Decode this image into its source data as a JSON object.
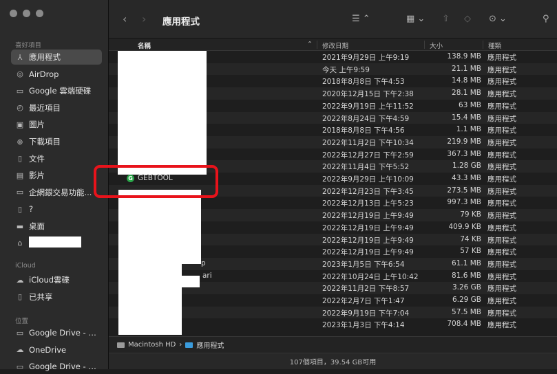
{
  "sidebar": {
    "favorites_title": "喜好項目",
    "items": [
      {
        "icon": "applications-icon",
        "glyph": "⅄",
        "label": "應用程式",
        "active": true
      },
      {
        "icon": "airdrop-icon",
        "glyph": "◎",
        "label": "AirDrop"
      },
      {
        "icon": "folder-icon",
        "glyph": "▭",
        "label": "Google 雲端硬碟"
      },
      {
        "icon": "clock-icon",
        "glyph": "◴",
        "label": "最近項目"
      },
      {
        "icon": "pictures-icon",
        "glyph": "▣",
        "label": "圖片"
      },
      {
        "icon": "download-icon",
        "glyph": "⊕",
        "label": "下載項目"
      },
      {
        "icon": "document-icon",
        "glyph": "▯",
        "label": "文件"
      },
      {
        "icon": "movies-icon",
        "glyph": "▤",
        "label": "影片"
      },
      {
        "icon": "folder-icon",
        "glyph": "▭",
        "label": "企網銀交易功能..."
      },
      {
        "icon": "document-icon",
        "glyph": "▯",
        "label": "?"
      },
      {
        "icon": "desktop-icon",
        "glyph": "▬",
        "label": "桌面"
      },
      {
        "icon": "home-icon",
        "glyph": "⌂",
        "label": ""
      }
    ],
    "icloud_title": "iCloud",
    "icloud_items": [
      {
        "icon": "cloud-icon",
        "glyph": "☁",
        "label": "iCloud雲碟"
      },
      {
        "icon": "shared-folder-icon",
        "glyph": "▯",
        "label": "已共享"
      }
    ],
    "locations_title": "位置",
    "location_items": [
      {
        "icon": "folder-icon",
        "glyph": "▭",
        "label": "Google Drive - g..."
      },
      {
        "icon": "cloud-icon",
        "glyph": "☁",
        "label": "OneDrive"
      },
      {
        "icon": "folder-icon",
        "glyph": "▭",
        "label": "Google Drive - b..."
      }
    ]
  },
  "toolbar": {
    "back": "‹",
    "forward": "›",
    "title": "應用程式",
    "view_icon": "list-view-icon",
    "group_icon": "group-icon",
    "share_icon": "share-icon",
    "tag_icon": "tag-icon",
    "more_icon": "more-icon",
    "search_icon": "search-icon"
  },
  "columns": {
    "name": "名稱",
    "date": "修改日期",
    "size": "大小",
    "kind": "種類"
  },
  "rows": [
    {
      "name": "",
      "date": "2021年9月29日 上午9:19",
      "size": "138.9 MB",
      "kind": "應用程式"
    },
    {
      "name": "",
      "date": "今天 上午9:59",
      "size": "21.1 MB",
      "kind": "應用程式"
    },
    {
      "name": "",
      "date": "2018年8月8日 下午4:53",
      "size": "14.8 MB",
      "kind": "應用程式"
    },
    {
      "name": "",
      "date": "2020年12月15日 下午2:38",
      "size": "28.1 MB",
      "kind": "應用程式"
    },
    {
      "name": "",
      "date": "2022年9月19日 上午11:52",
      "size": "63 MB",
      "kind": "應用程式"
    },
    {
      "name": "",
      "date": "2022年8月24日 下午4:59",
      "size": "15.4 MB",
      "kind": "應用程式"
    },
    {
      "name": "",
      "date": "2018年8月8日 下午4:56",
      "size": "1.1 MB",
      "kind": "應用程式"
    },
    {
      "name": "",
      "date": "2022年11月2日 下午10:34",
      "size": "219.9 MB",
      "kind": "應用程式"
    },
    {
      "name": "",
      "date": "2022年12月27日 下午2:59",
      "size": "367.3 MB",
      "kind": "應用程式"
    },
    {
      "name": "",
      "date": "2022年11月4日 下午5:52",
      "size": "1.28 GB",
      "kind": "應用程式"
    },
    {
      "name": "GEBTOOL",
      "date": "2022年9月29日 上午10:09",
      "size": "43.3 MB",
      "kind": "應用程式"
    },
    {
      "name": "",
      "date": "2022年12月23日 下午3:45",
      "size": "273.5 MB",
      "kind": "應用程式"
    },
    {
      "name": "",
      "date": "2022年12月13日 上午5:23",
      "size": "997.3 MB",
      "kind": "應用程式"
    },
    {
      "name": "",
      "date": "2022年12月19日 上午9:49",
      "size": "79 KB",
      "kind": "應用程式"
    },
    {
      "name": "",
      "date": "2022年12月19日 上午9:49",
      "size": "409.9 KB",
      "kind": "應用程式"
    },
    {
      "name": "",
      "date": "2022年12月19日 上午9:49",
      "size": "74 KB",
      "kind": "應用程式"
    },
    {
      "name": "",
      "date": "2022年12月19日 上午9:49",
      "size": "57 KB",
      "kind": "應用程式"
    },
    {
      "name": "p",
      "date": "2023年1月5日 下午6:54",
      "size": "61.1 MB",
      "kind": "應用程式"
    },
    {
      "name": "ari",
      "date": "2022年10月24日 上午10:42",
      "size": "81.6 MB",
      "kind": "應用程式"
    },
    {
      "name": "",
      "date": "2022年11月2日 下午8:57",
      "size": "3.26 GB",
      "kind": "應用程式"
    },
    {
      "name": "",
      "date": "2022年2月7日 下午1:47",
      "size": "6.29 GB",
      "kind": "應用程式"
    },
    {
      "name": "",
      "date": "2022年9月19日 下午7:04",
      "size": "57.5 MB",
      "kind": "應用程式"
    },
    {
      "name": "",
      "date": "2023年1月3日 下午4:14",
      "size": "708.4 MB",
      "kind": "應用程式"
    }
  ],
  "pathbar": {
    "disk": "Macintosh HD",
    "separator": "›",
    "folder": "應用程式"
  },
  "status": "107個項目，39.54 GB可用",
  "colors": {
    "highlight": "#e8131b",
    "gebtool_icon": "#2aa84a",
    "folder": "#3a9bdc"
  }
}
